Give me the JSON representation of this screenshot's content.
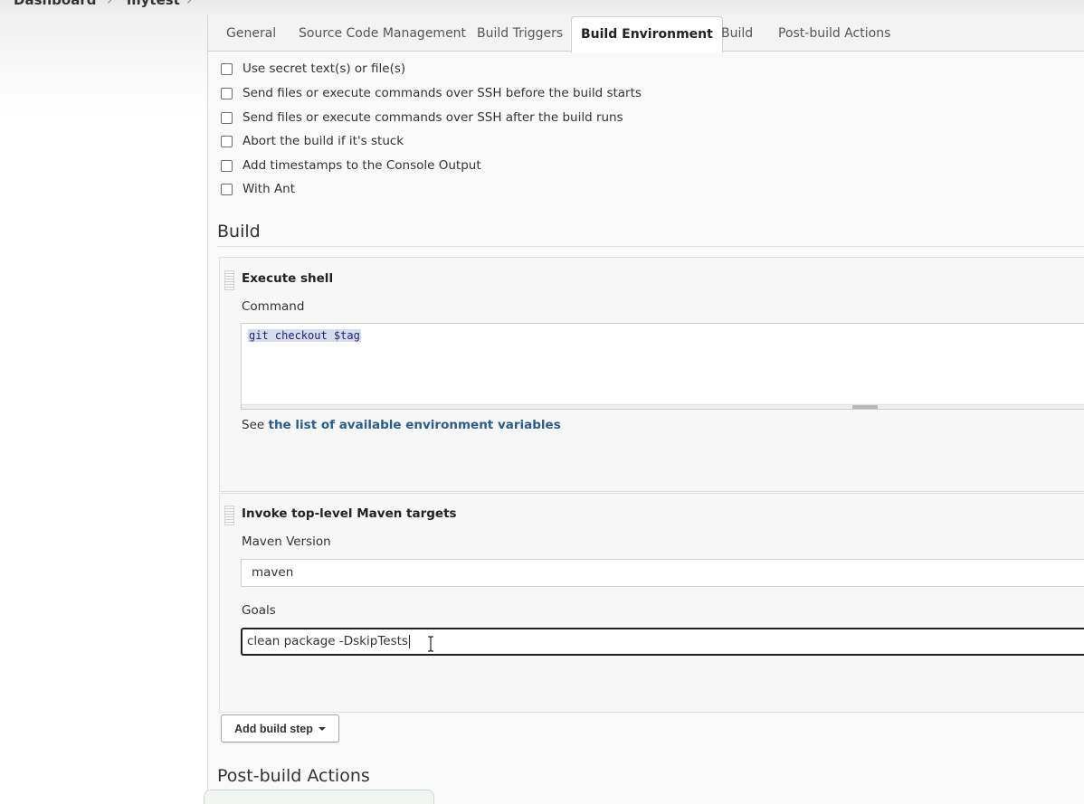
{
  "breadcrumb": {
    "dashboard": "Dashboard",
    "separator": "›",
    "job": "mytest",
    "chevron": "›"
  },
  "tabs": [
    {
      "label": "General"
    },
    {
      "label": "Source Code Management"
    },
    {
      "label": "Build Triggers"
    },
    {
      "label": "Build Environment",
      "active": true
    },
    {
      "label": "Build"
    },
    {
      "label": "Post-build Actions"
    }
  ],
  "build_environment": {
    "options": [
      {
        "label": "Use secret text(s) or file(s)",
        "checked": false
      },
      {
        "label": "Send files or execute commands over SSH before the build starts",
        "checked": false
      },
      {
        "label": "Send files or execute commands over SSH after the build runs",
        "checked": false
      },
      {
        "label": "Abort the build if it's stuck",
        "checked": false
      },
      {
        "label": "Add timestamps to the Console Output",
        "checked": false
      },
      {
        "label": "With Ant",
        "checked": false
      }
    ]
  },
  "build": {
    "title": "Build",
    "execute_shell": {
      "title": "Execute shell",
      "command_label": "Command",
      "command_value": "git checkout $tag",
      "hint_prefix": "See ",
      "hint_link": "the list of available environment variables"
    },
    "maven": {
      "title": "Invoke top-level Maven targets",
      "version_label": "Maven Version",
      "version_value": "maven",
      "goals_label": "Goals",
      "goals_value": "clean package -DskipTests"
    },
    "add_step_label": "Add build step"
  },
  "post_build": {
    "title": "Post-build Actions"
  },
  "colors": {
    "link": "#2a5d8f",
    "code_text": "#1a237e",
    "code_highlight": "#d7dced"
  }
}
